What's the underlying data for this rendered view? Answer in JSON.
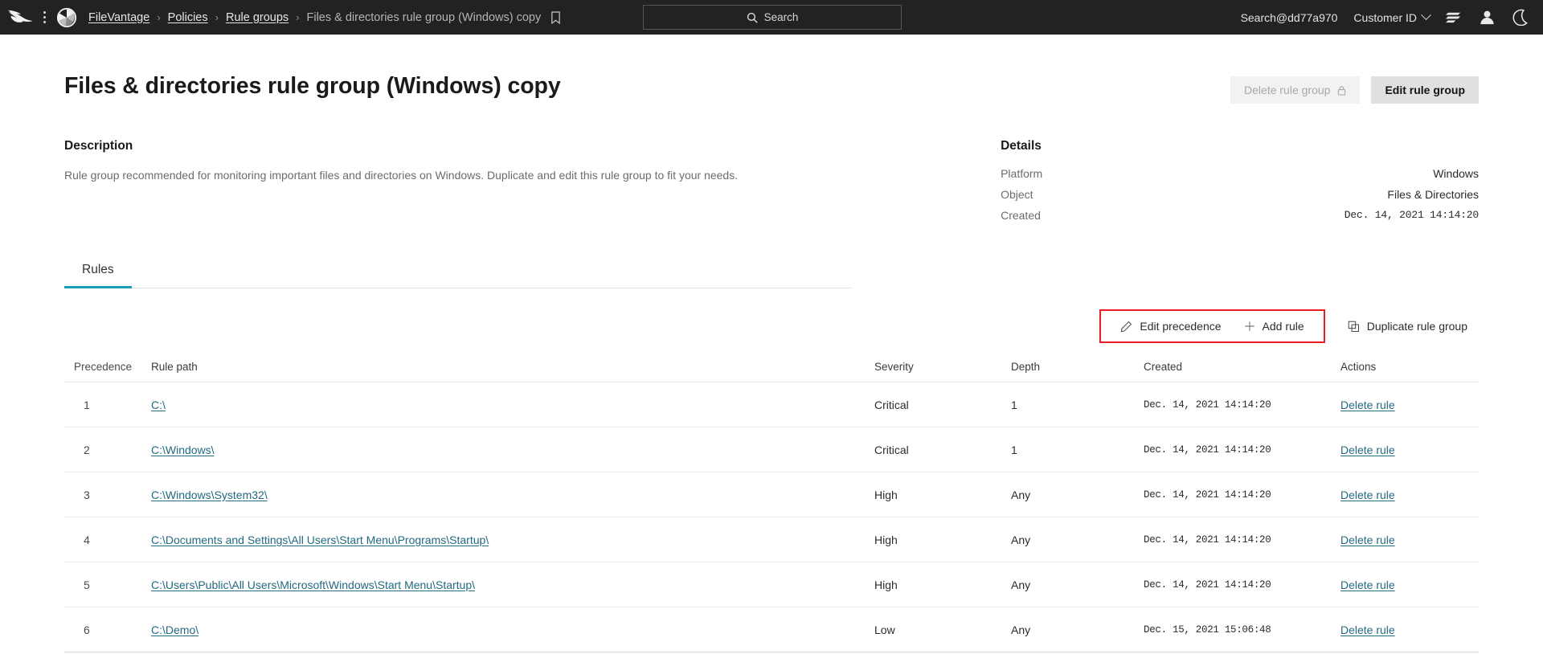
{
  "topbar": {
    "logo": "falcon-logo",
    "menu_icon": "kebab-menu-icon",
    "app_icon": "filevantage-app-icon",
    "breadcrumb": [
      {
        "label": "FileVantage",
        "link": true
      },
      {
        "label": "Policies",
        "link": true
      },
      {
        "label": "Rule groups",
        "link": true
      },
      {
        "label": "Files & directories rule group (Windows) copy",
        "link": false
      }
    ],
    "separator": "›",
    "bookmark_icon": "bookmark-icon",
    "search": {
      "label": "Search",
      "icon": "search-icon"
    },
    "user": "Search@dd77a970",
    "customer_id": "Customer ID",
    "icons": [
      "list-icon",
      "user-icon",
      "moon-icon"
    ]
  },
  "header": {
    "title": "Files & directories rule group (Windows) copy",
    "delete_button": "Delete rule group",
    "delete_icon": "lock-icon",
    "edit_button": "Edit rule group"
  },
  "description": {
    "heading": "Description",
    "text": "Rule group recommended for monitoring important files and directories on Windows. Duplicate and edit this rule group to fit your needs."
  },
  "details": {
    "heading": "Details",
    "rows": [
      {
        "key": "Platform",
        "value": "Windows",
        "mono": false
      },
      {
        "key": "Object",
        "value": "Files & Directories",
        "mono": false
      },
      {
        "key": "Created",
        "value": "Dec. 14, 2021 14:14:20",
        "mono": true
      }
    ]
  },
  "tabs": [
    {
      "label": "Rules",
      "active": true
    }
  ],
  "toolbar": {
    "edit_precedence": "Edit precedence",
    "edit_precedence_icon": "pencil-icon",
    "add_rule": "Add rule",
    "add_rule_icon": "plus-icon",
    "duplicate_rule_group": "Duplicate rule group",
    "duplicate_icon": "copy-icon",
    "highlight_color": "#ed1c24"
  },
  "table": {
    "columns": [
      "Precedence",
      "Rule path",
      "Severity",
      "Depth",
      "Created",
      "Actions"
    ],
    "rows": [
      {
        "precedence": "1",
        "path": "C:\\",
        "severity": "Critical",
        "depth": "1",
        "created": "Dec. 14, 2021 14:14:20",
        "action": "Delete rule"
      },
      {
        "precedence": "2",
        "path": "C:\\Windows\\",
        "severity": "Critical",
        "depth": "1",
        "created": "Dec. 14, 2021 14:14:20",
        "action": "Delete rule"
      },
      {
        "precedence": "3",
        "path": "C:\\Windows\\System32\\",
        "severity": "High",
        "depth": "Any",
        "created": "Dec. 14, 2021 14:14:20",
        "action": "Delete rule"
      },
      {
        "precedence": "4",
        "path": "C:\\Documents and Settings\\All Users\\Start Menu\\Programs\\Startup\\",
        "severity": "High",
        "depth": "Any",
        "created": "Dec. 14, 2021 14:14:20",
        "action": "Delete rule"
      },
      {
        "precedence": "5",
        "path": "C:\\Users\\Public\\All Users\\Microsoft\\Windows\\Start Menu\\Startup\\",
        "severity": "High",
        "depth": "Any",
        "created": "Dec. 14, 2021 14:14:20",
        "action": "Delete rule"
      },
      {
        "precedence": "6",
        "path": "C:\\Demo\\",
        "severity": "Low",
        "depth": "Any",
        "created": "Dec. 15, 2021 15:06:48",
        "action": "Delete rule"
      }
    ]
  },
  "colors": {
    "topbar_bg": "#222222",
    "tab_accent": "#1a9dbd",
    "link": "#236a80"
  }
}
